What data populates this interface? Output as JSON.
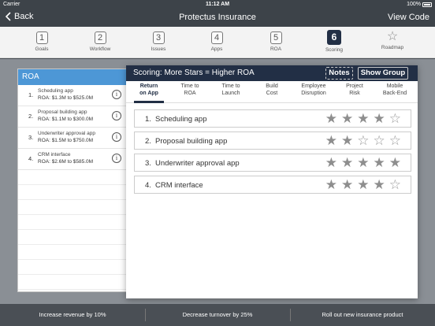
{
  "status": {
    "carrier": "Carrier",
    "time": "11:12 AM",
    "battery": "100%"
  },
  "nav": {
    "back": "Back",
    "title": "Protectus Insurance",
    "right": "View Code"
  },
  "steps": [
    {
      "num": "1",
      "label": "Goals"
    },
    {
      "num": "2",
      "label": "Workflow"
    },
    {
      "num": "3",
      "label": "Issues"
    },
    {
      "num": "4",
      "label": "Apps"
    },
    {
      "num": "5",
      "label": "ROA"
    },
    {
      "num": "6",
      "label": "Scoring",
      "active": true
    },
    {
      "icon": "star-icon",
      "label": "Roadmap"
    }
  ],
  "roa": {
    "header": "ROA",
    "items": [
      {
        "idx": "1.",
        "name": "Scheduling app",
        "value": "ROA: $1.3M to $525.0M"
      },
      {
        "idx": "2.",
        "name": "Proposal building app",
        "value": "ROA: $1.1M to $300.0M"
      },
      {
        "idx": "3.",
        "name": "Underwriter approval app",
        "value": "ROA: $1.5M to $750.0M"
      },
      {
        "idx": "4.",
        "name": "CRM interface",
        "value": "ROA: $2.6M to $585.0M"
      }
    ]
  },
  "scoring": {
    "title": "Scoring: More Stars = Higher ROA",
    "notes": "Notes",
    "show_group": "Show Group",
    "tabs": [
      {
        "l1": "Return",
        "l2": "on App"
      },
      {
        "l1": "Time to",
        "l2": "ROA"
      },
      {
        "l1": "Time to",
        "l2": "Launch"
      },
      {
        "l1": "Build",
        "l2": "Cost"
      },
      {
        "l1": "Employee",
        "l2": "Disruption"
      },
      {
        "l1": "Project",
        "l2": "Risk"
      },
      {
        "l1": "Mobile",
        "l2": "Back-End"
      }
    ],
    "rows": [
      {
        "idx": "1.",
        "name": "Scheduling app",
        "stars": 4
      },
      {
        "idx": "2.",
        "name": "Proposal building app",
        "stars": 2
      },
      {
        "idx": "3.",
        "name": "Underwriter approval app",
        "stars": 5
      },
      {
        "idx": "4.",
        "name": "CRM interface",
        "stars": 4
      }
    ],
    "max_stars": 5
  },
  "goals": [
    "Increase revenue by 10%",
    "Decrease turnover by 25%",
    "Roll out new insurance product"
  ]
}
